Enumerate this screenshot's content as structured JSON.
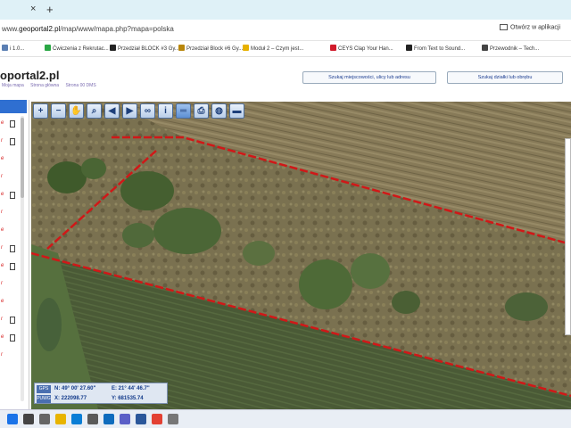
{
  "browser": {
    "tab_close": "×",
    "tab_new": "+",
    "url_host": "geoportal2.pl",
    "url_path": "/map/www/mapa.php?mapa=polska",
    "url_prefix": "www.",
    "open_app_label": "Otwórz w aplikacji",
    "bookmarks": [
      {
        "label": "i 1.0...",
        "color": "#5b7fb3"
      },
      {
        "label": "Ćwiczenia z Rekrutac...",
        "color": "#2aa745"
      },
      {
        "label": "Przedział BLOCK #3 Gy...",
        "color": "#222222"
      },
      {
        "label": "Przedział Block #6 Gy...",
        "color": "#b8860b"
      },
      {
        "label": "Moduł 2 – Czym jest...",
        "color": "#e7b100"
      },
      {
        "label": "CEYS Clap Your Han...",
        "color": "#d11a2a"
      },
      {
        "label": "From Text to Sound...",
        "color": "#222222"
      },
      {
        "label": "Przewodnik – Tech...",
        "color": "#444444"
      }
    ]
  },
  "site": {
    "title_visible": "oportal2.pl",
    "nav": [
      "Moja mapa",
      "Strona główna",
      "Strona 00 DMS"
    ],
    "search_address_button": "Szukaj miejscowości, ulicy lub adresu",
    "search_parcel_button": "Szukaj działki lub obrębu"
  },
  "left_panel": {
    "items": [
      {
        "text": "e",
        "has_doc": true
      },
      {
        "text": "r",
        "has_doc": true
      },
      {
        "text": "e",
        "has_doc": false
      },
      {
        "text": "r",
        "has_doc": false
      },
      {
        "text": "e",
        "has_doc": true
      },
      {
        "text": "r",
        "has_doc": false
      },
      {
        "text": "e",
        "has_doc": false
      },
      {
        "text": "r",
        "has_doc": true
      },
      {
        "text": "e",
        "has_doc": true
      },
      {
        "text": "r",
        "has_doc": false
      },
      {
        "text": "e",
        "has_doc": false
      },
      {
        "text": "r",
        "has_doc": true
      },
      {
        "text": "e",
        "has_doc": true
      },
      {
        "text": "r",
        "has_doc": false
      }
    ]
  },
  "map": {
    "toolbar": [
      {
        "name": "zoom-in-icon",
        "glyph": "+"
      },
      {
        "name": "zoom-out-icon",
        "glyph": "−"
      },
      {
        "name": "pan-hand-icon",
        "glyph": "✋"
      },
      {
        "name": "zoom-window-icon",
        "glyph": "⌕"
      },
      {
        "name": "back-arrow-icon",
        "glyph": "◀"
      },
      {
        "name": "forward-arrow-icon",
        "glyph": "▶"
      },
      {
        "name": "link-icon",
        "glyph": "∞"
      },
      {
        "name": "info-icon",
        "glyph": "i"
      },
      {
        "name": "measure-icon",
        "glyph": "═",
        "active": true
      },
      {
        "name": "print-icon",
        "glyph": "⎙"
      },
      {
        "name": "globe-icon",
        "glyph": "◍"
      },
      {
        "name": "camera-icon",
        "glyph": "▬"
      }
    ],
    "coords": {
      "tag1": "GPS",
      "tag2": "PUWG",
      "n": "N: 49° 00' 27.60\"",
      "e": "E: 21° 44' 46.7\"",
      "x": "X: 222098.77",
      "y": "Y: 681535.74"
    },
    "boundary_color": "#d01818"
  },
  "taskbar": {
    "icons": [
      "windows-icon",
      "search-icon",
      "taskview-icon",
      "explorer-icon",
      "edge-icon",
      "store-icon",
      "mail-icon",
      "teams-icon",
      "word-icon",
      "chrome-icon",
      "settings-icon"
    ]
  }
}
